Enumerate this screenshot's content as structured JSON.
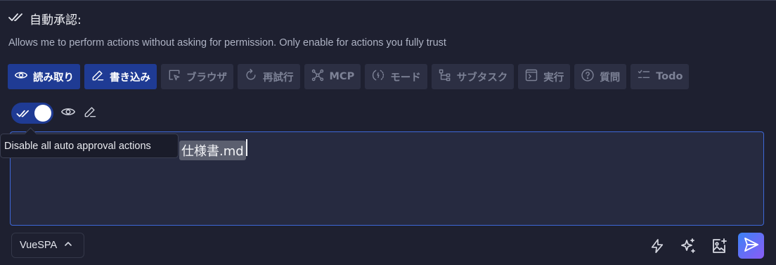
{
  "header": {
    "title": "自動承認:",
    "icon": "double-check-icon",
    "description": "Allows me to perform actions without asking for permission. Only enable for actions you fully trust"
  },
  "actions": [
    {
      "id": "read",
      "label": "読み取り",
      "icon": "eye-icon",
      "active": true
    },
    {
      "id": "write",
      "label": "書き込み",
      "icon": "pencil-icon",
      "active": true
    },
    {
      "id": "browser",
      "label": "ブラウザ",
      "icon": "cursor-window-icon",
      "active": false
    },
    {
      "id": "retry",
      "label": "再試行",
      "icon": "refresh-icon",
      "active": false
    },
    {
      "id": "mcp",
      "label": "MCP",
      "icon": "hub-icon",
      "active": false
    },
    {
      "id": "mode",
      "label": "モード",
      "icon": "mode-switch-icon",
      "active": false
    },
    {
      "id": "subtask",
      "label": "サブタスク",
      "icon": "subtask-icon",
      "active": false
    },
    {
      "id": "execute",
      "label": "実行",
      "icon": "terminal-icon",
      "active": false
    },
    {
      "id": "question",
      "label": "質問",
      "icon": "question-icon",
      "active": false
    },
    {
      "id": "todo",
      "label": "Todo",
      "icon": "checklist-icon",
      "active": false
    }
  ],
  "toggle": {
    "on": true,
    "icons": [
      "double-check-icon",
      "eye-icon",
      "pencil-icon"
    ]
  },
  "tooltip": {
    "text": "Disable all auto approval actions"
  },
  "editor": {
    "file_chip": "仕様書.md"
  },
  "footer": {
    "mode_label": "VueSPA",
    "icons": [
      "lightning-icon",
      "sparkle-icon",
      "image-add-icon",
      "send-icon"
    ]
  },
  "colors": {
    "accent": "#1f3b94",
    "focus_border": "#3e68d8",
    "send_gradient_start": "#3b82f6",
    "send_gradient_end": "#8b5cf6"
  }
}
